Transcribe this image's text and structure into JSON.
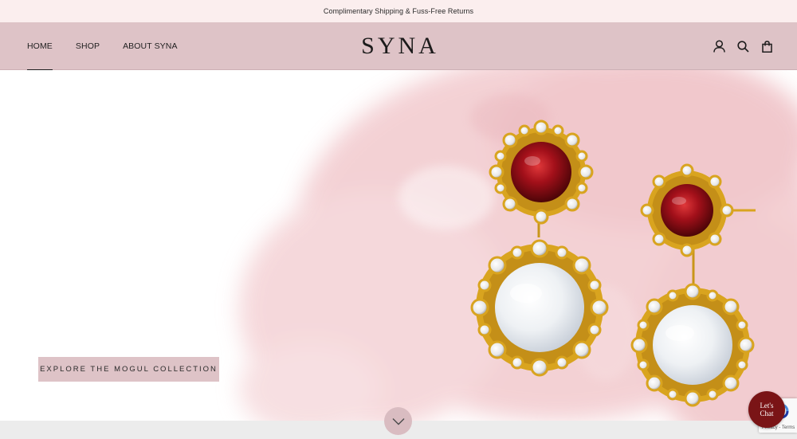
{
  "announcement": "Complimentary Shipping & Fuss-Free Returns",
  "nav": {
    "items": [
      {
        "label": "HOME",
        "active": true
      },
      {
        "label": "SHOP",
        "active": false
      },
      {
        "label": "ABOUT SYNA",
        "active": false
      }
    ]
  },
  "brand": {
    "logo": "SYNA"
  },
  "header_icons": [
    "account-icon",
    "search-icon",
    "cart-icon"
  ],
  "hero": {
    "cta_label": "EXPLORE THE MOGUL COLLECTION",
    "scroll_icon": "chevron-down-icon"
  },
  "chat": {
    "line1": "Let's",
    "line2": "Chat"
  },
  "recaptcha": {
    "text": "Privacy - Terms"
  },
  "colors": {
    "announcement_bg": "#fbeeee",
    "header_bg": "#dec3c7",
    "cta_bg": "#dec3c7",
    "chat_bg": "#7a1416",
    "garnet": "#8e0d0f",
    "gold": "#d9a41f"
  }
}
